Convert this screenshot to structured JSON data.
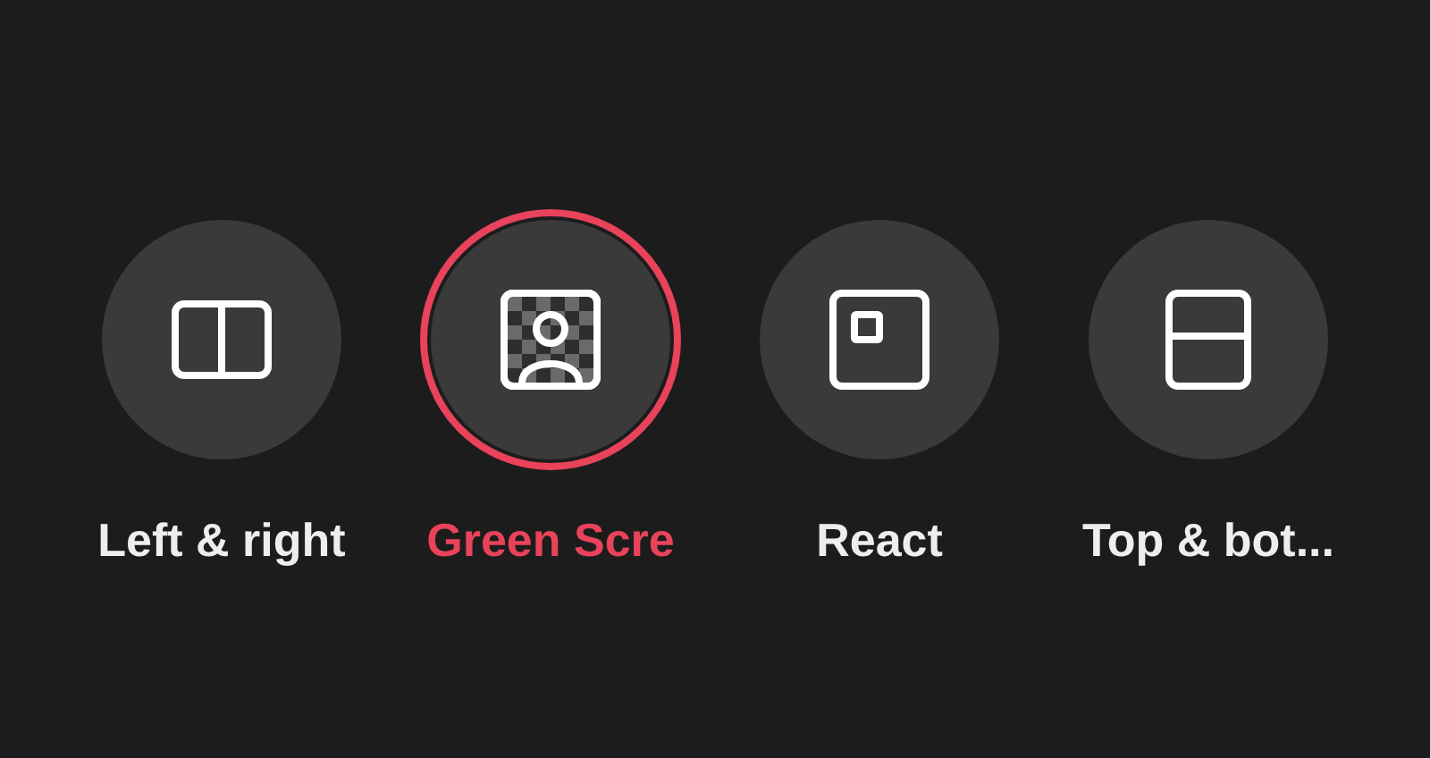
{
  "options": [
    {
      "kind": "split-vertical",
      "label": "Left & right",
      "selected": false
    },
    {
      "kind": "green-screen",
      "label": "Green Scre",
      "selected": true
    },
    {
      "kind": "picture-in-picture",
      "label": "React",
      "selected": false
    },
    {
      "kind": "split-horizontal",
      "label": "Top & bot...",
      "selected": false
    }
  ]
}
